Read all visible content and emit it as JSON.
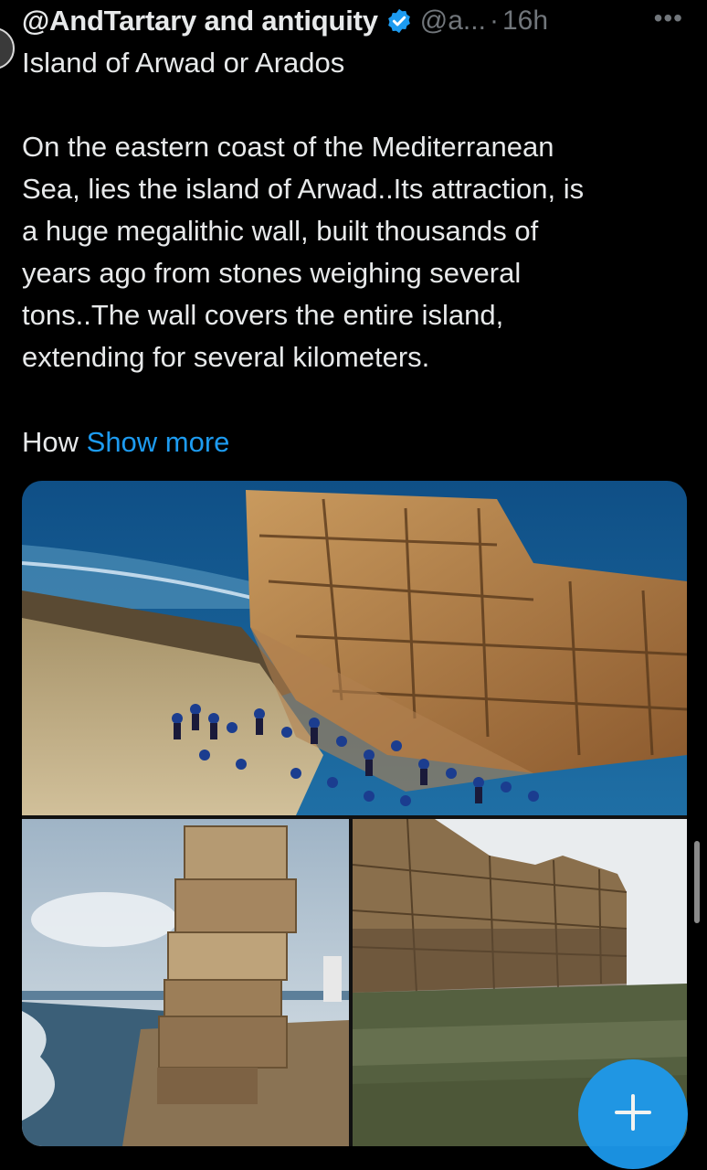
{
  "post": {
    "author_name": "@AndTartary and antiquity",
    "handle": "@a...",
    "separator": "·",
    "time": "16h",
    "more_label": "•••",
    "title": "Island of Arwad or Arados",
    "body_lines": [
      "On the eastern coast of the Mediterranean",
      "Sea, lies the island of Arwad..Its attraction, is",
      "a huge megalithic wall, built thousands of",
      "years ago from stones weighing several",
      "tons..The wall covers the entire island,",
      "extending for several kilometers."
    ],
    "truncated_word": "How ",
    "show_more": "Show more"
  },
  "media": {
    "photos": [
      {
        "name": "photo-megalithic-wall-with-crowd"
      },
      {
        "name": "photo-stacked-stone-pillar"
      },
      {
        "name": "photo-ruined-wall-on-shore"
      }
    ]
  },
  "colors": {
    "background": "#000000",
    "text": "#e7e9ea",
    "muted": "#71767b",
    "accent": "#1d9bf0"
  },
  "icons": {
    "verified": "verified-badge-icon",
    "more": "more-dots-icon",
    "compose": "plus-icon"
  }
}
